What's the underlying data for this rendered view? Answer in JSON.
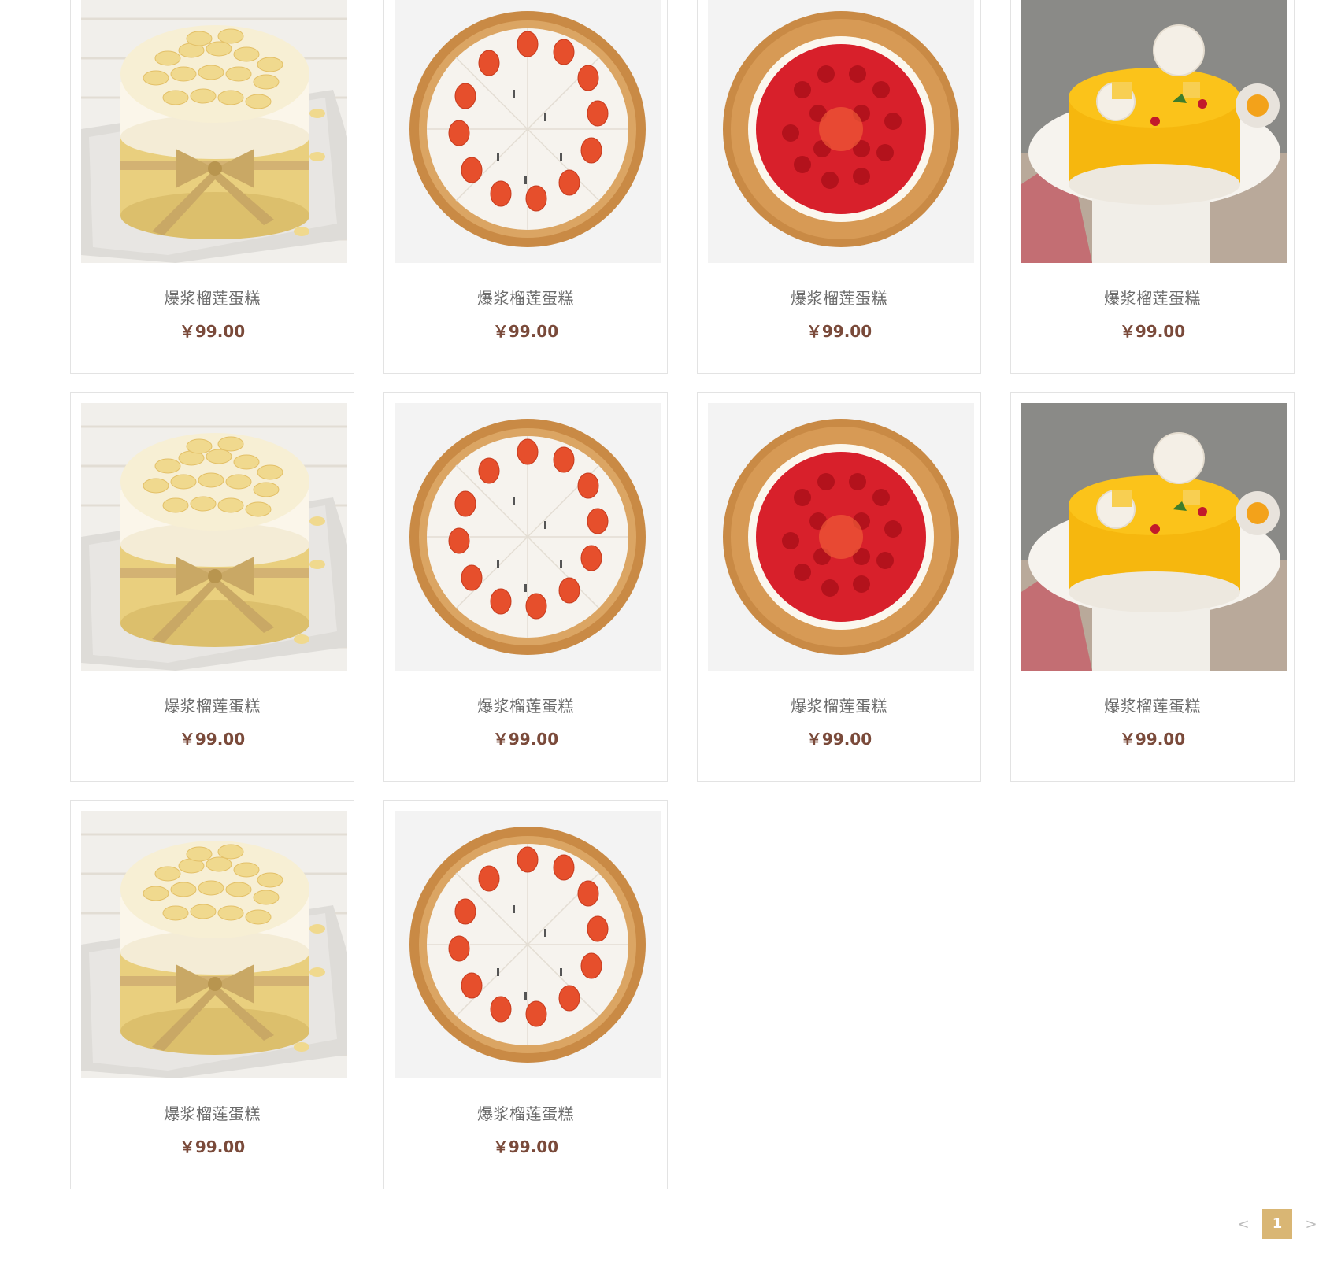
{
  "products": [
    {
      "name": "爆浆榴莲蛋糕",
      "price": "￥99.00",
      "image": "almond-cake-icon"
    },
    {
      "name": "爆浆榴莲蛋糕",
      "price": "￥99.00",
      "image": "strawberry-tart-icon"
    },
    {
      "name": "爆浆榴莲蛋糕",
      "price": "￥99.00",
      "image": "cherry-tart-icon"
    },
    {
      "name": "爆浆榴莲蛋糕",
      "price": "￥99.00",
      "image": "mango-cake-icon"
    },
    {
      "name": "爆浆榴莲蛋糕",
      "price": "￥99.00",
      "image": "almond-cake-icon"
    },
    {
      "name": "爆浆榴莲蛋糕",
      "price": "￥99.00",
      "image": "strawberry-tart-icon"
    },
    {
      "name": "爆浆榴莲蛋糕",
      "price": "￥99.00",
      "image": "cherry-tart-icon"
    },
    {
      "name": "爆浆榴莲蛋糕",
      "price": "￥99.00",
      "image": "mango-cake-icon"
    },
    {
      "name": "爆浆榴莲蛋糕",
      "price": "￥99.00",
      "image": "almond-cake-icon"
    },
    {
      "name": "爆浆榴莲蛋糕",
      "price": "￥99.00",
      "image": "strawberry-tart-icon"
    }
  ],
  "pagination": {
    "prev": "<",
    "current": "1",
    "next": ">"
  },
  "colors": {
    "price": "#7a4a3a",
    "name": "#6b6b6b",
    "page_active": "#d9b674",
    "card_border": "#e3e3e3"
  }
}
